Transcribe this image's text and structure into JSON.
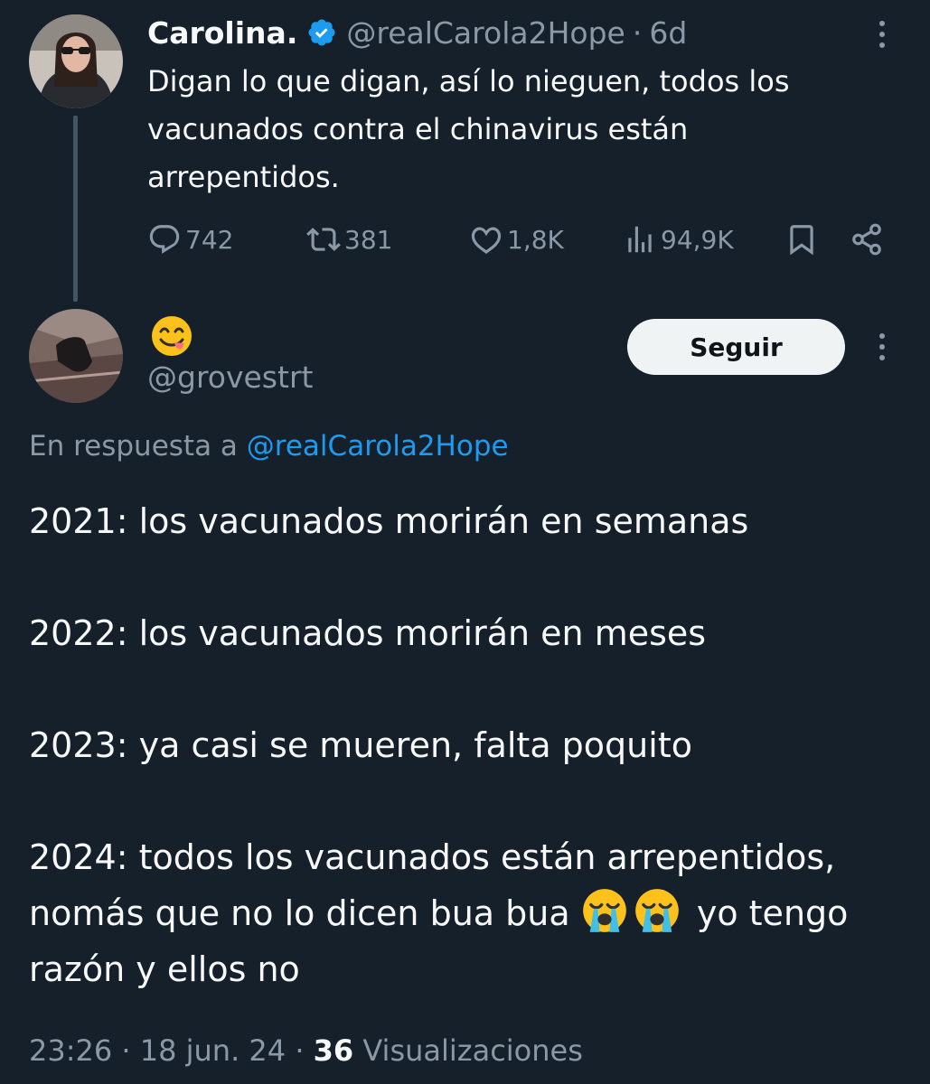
{
  "parent_tweet": {
    "name": "Carolina.",
    "handle": "@realCarola2Hope",
    "separator": "·",
    "time": "6d",
    "text": "Digan lo que digan, así lo nieguen, todos los vacunados contra el chinavirus están arrepentidos.",
    "stats": {
      "replies": "742",
      "retweets": "381",
      "likes": "1,8K",
      "views": "94,9K"
    }
  },
  "reply_tweet": {
    "display_name_icon": "yum-face-emoji",
    "handle": "@grovestrt",
    "follow_label": "Seguir",
    "reply_prefix": "En respuesta a",
    "reply_mention": "@realCarola2Hope",
    "lines": {
      "l2021": "2021: los vacunados morirán en semanas",
      "l2022": "2022: los vacunados morirán en meses",
      "l2023": "2023: ya casi se mueren, falta poquito",
      "l2024_start": "2024: todos los vacunados están arrepentidos, nomás que no lo dicen bua bua",
      "l2024_end": "yo tengo razón y ellos no"
    },
    "time": "23:26",
    "date": "18 jun. 24",
    "views_count": "36",
    "views_label": "Visualizaciones",
    "separator": "·"
  },
  "colors": {
    "background": "#15202b",
    "text": "#f7f9f9",
    "muted": "#8b98a5",
    "link": "#1d9bf0",
    "verified": "#1d9bf0"
  }
}
